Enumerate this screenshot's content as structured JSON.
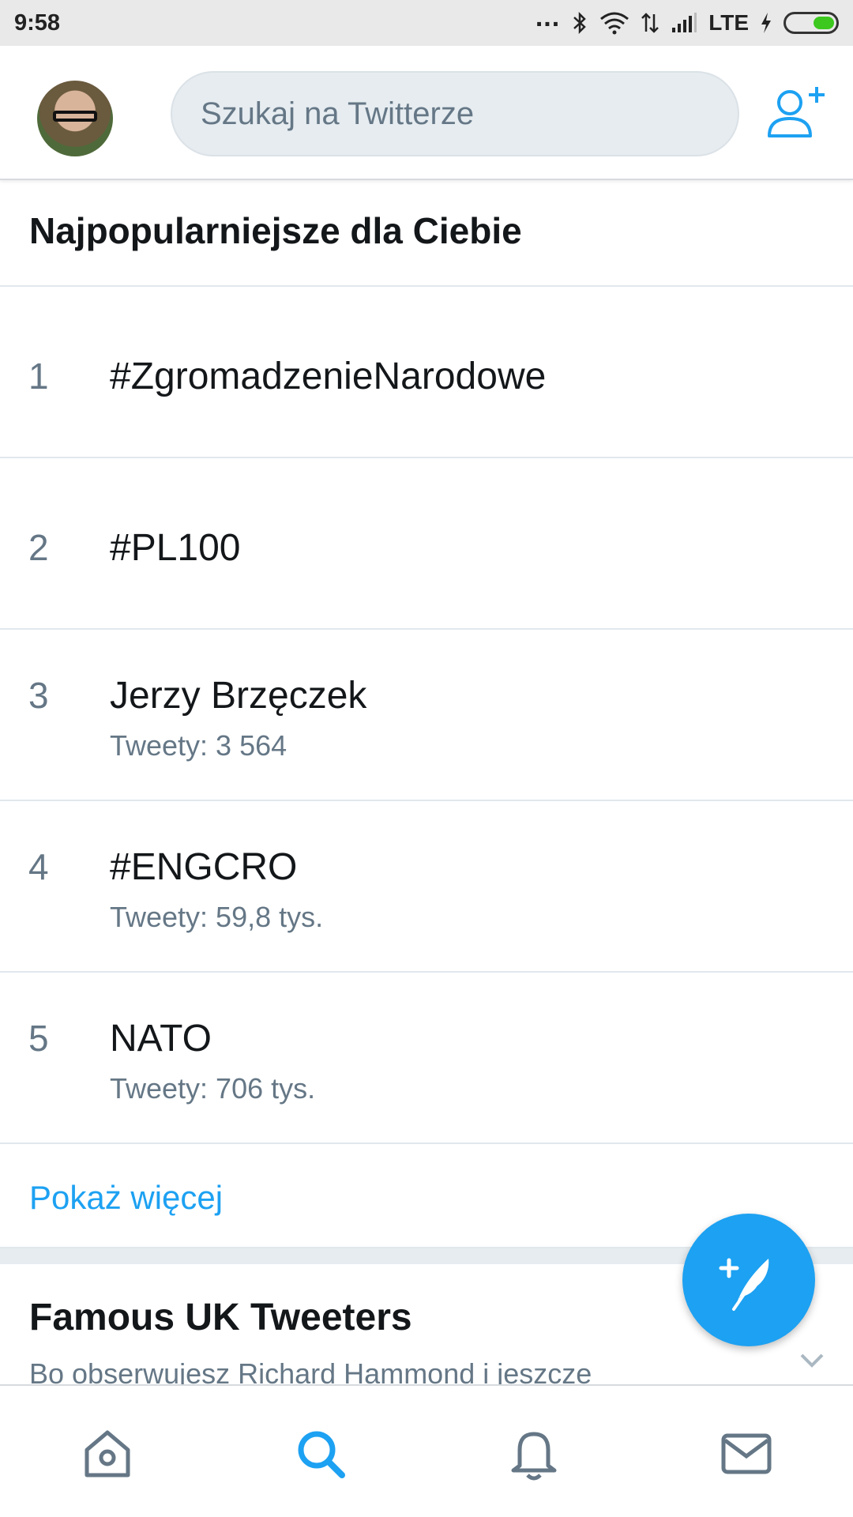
{
  "status_bar": {
    "time": "9:58",
    "network": "LTE",
    "dots": "..."
  },
  "header": {
    "search_placeholder": "Szukaj na Twitterze",
    "avatar_icon": "user-avatar",
    "add_user_icon": "add-user-icon"
  },
  "trends": {
    "title": "Najpopularniejsze dla Ciebie",
    "items": [
      {
        "rank": "1",
        "name": "#ZgromadzenieNarodowe",
        "count": ""
      },
      {
        "rank": "2",
        "name": "#PL100",
        "count": ""
      },
      {
        "rank": "3",
        "name": "Jerzy Brzęczek",
        "count": "Tweety: 3 564"
      },
      {
        "rank": "4",
        "name": "#ENGCRO",
        "count": "Tweety: 59,8 tys."
      },
      {
        "rank": "5",
        "name": "NATO",
        "count": "Tweety: 706 tys."
      }
    ],
    "show_more": "Pokaż więcej"
  },
  "famous": {
    "title": "Famous UK Tweeters",
    "subtitle": "Bo obserwujesz Richard Hammond i jeszcze"
  },
  "fab": {
    "icon": "compose-tweet-icon"
  },
  "bottom_nav": {
    "icons": [
      "home-icon",
      "search-icon",
      "notifications-icon",
      "messages-icon"
    ]
  },
  "colors": {
    "accent": "#1da1f2",
    "text": "#14171a",
    "secondary": "#657786",
    "battery": "#3cc81e"
  }
}
